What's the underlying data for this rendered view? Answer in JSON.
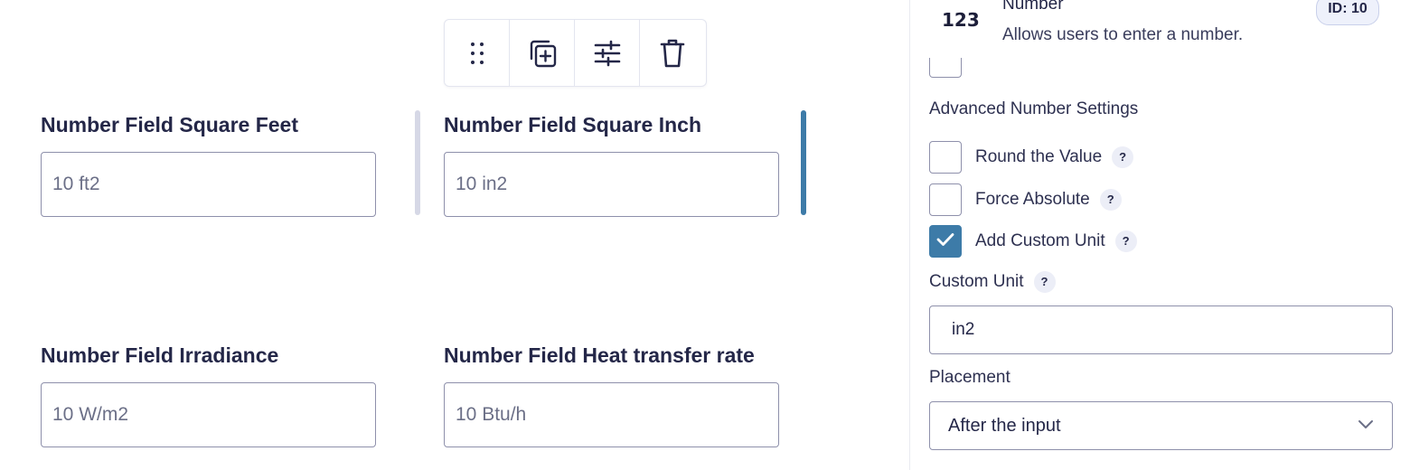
{
  "toolbar": {
    "icons": [
      "drag-handle-icon",
      "duplicate-icon",
      "settings-sliders-icon",
      "trash-icon"
    ]
  },
  "fields": [
    {
      "label": "Number Field Square Feet",
      "placeholder": "10 ft2"
    },
    {
      "label": "Number Field Square Inch",
      "placeholder": "10 in2"
    },
    {
      "label": "Number Field Irradiance",
      "placeholder": "10 W/m2"
    },
    {
      "label": "Number Field Heat transfer rate",
      "placeholder": "10 Btu/h"
    }
  ],
  "panel": {
    "field_type": {
      "icon_text": "123",
      "name": "Number",
      "description": "Allows users to enter a number.",
      "id_badge": "ID: 10"
    },
    "advanced_title": "Advanced Number Settings",
    "options": [
      {
        "label": "Round the Value",
        "checked": false,
        "help": "?"
      },
      {
        "label": "Force Absolute",
        "checked": false,
        "help": "?"
      },
      {
        "label": "Add Custom Unit",
        "checked": true,
        "help": "?"
      }
    ],
    "custom_unit": {
      "label": "Custom Unit",
      "help": "?",
      "value": "in2"
    },
    "placement": {
      "label": "Placement",
      "value": "After the input"
    }
  },
  "colors": {
    "accent": "#3d7ba8",
    "border": "#8e90ab",
    "text": "#242748"
  }
}
